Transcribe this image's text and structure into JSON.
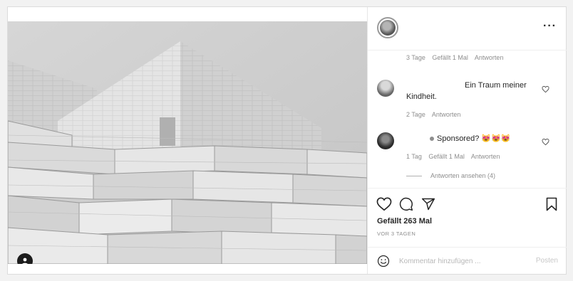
{
  "photo": {
    "tag_icon": "user-icon"
  },
  "header": {
    "more_label": "···"
  },
  "comments": [
    {
      "text": "",
      "meta": {
        "age": "3 Tage",
        "likes": "Gefällt 1 Mal",
        "reply": "Antworten"
      }
    },
    {
      "text_line1": "Ein Traum meiner",
      "text_line2": "Kindheit.",
      "meta": {
        "age": "2 Tage",
        "reply": "Antworten"
      }
    },
    {
      "text": "Sponsored? 😻😻😻",
      "meta": {
        "age": "1 Tag",
        "likes": "Gefällt 1 Mal",
        "reply": "Antworten"
      },
      "view_replies": "Antworten ansehen (4)"
    }
  ],
  "actions": {
    "likes_label": "Gefällt 263 Mal",
    "time_ago": "VOR 3 TAGEN"
  },
  "comment_box": {
    "placeholder": "Kommentar hinzufügen ...",
    "post_label": "Posten"
  }
}
